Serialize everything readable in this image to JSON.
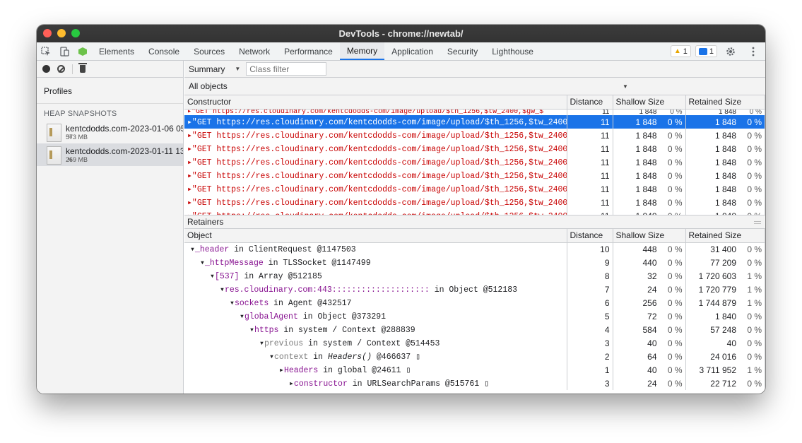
{
  "window": {
    "title": "DevTools - chrome://newtab/"
  },
  "tabs": [
    "Elements",
    "Console",
    "Sources",
    "Network",
    "Performance",
    "Memory",
    "Application",
    "Security",
    "Lighthouse"
  ],
  "active_tab": "Memory",
  "badges": {
    "warnings": "1",
    "messages": "1"
  },
  "sidebar": {
    "profiles_title": "Profiles",
    "section": "HEAP SNAPSHOTS",
    "snapshots": [
      {
        "title": "kentcdodds.com-2023-01-06 05",
        "size": "573 MB",
        "pct": "%"
      },
      {
        "title": "kentcdodds.com-2023-01-11 13",
        "size": "269 MB",
        "pct": "%"
      }
    ]
  },
  "toolbar": {
    "view": "Summary",
    "class_filter_placeholder": "Class filter",
    "objects_select": "All objects"
  },
  "constructor_table": {
    "headers": [
      "Constructor",
      "Distance",
      "Shallow Size",
      "Retained Size"
    ],
    "clipped_row": {
      "name": "▸\"GET https://res.cloudinary.com/kentcdodds-com/image/upload/$th_1256,$tw_2400,$gw_$",
      "distance": "11",
      "shallow": "1 848",
      "shallow_pct": "0 %",
      "retained": "1 848",
      "retained_pct": "0 %"
    },
    "rows": [
      {
        "name": "▸\"GET https://res.cloudinary.com/kentcdodds-com/image/upload/$th_1256,$tw_2400,$gw_$",
        "distance": "11",
        "shallow": "1 848",
        "shallow_pct": "0 %",
        "retained": "1 848",
        "retained_pct": "0 %"
      },
      {
        "name": "▸\"GET https://res.cloudinary.com/kentcdodds-com/image/upload/$th_1256,$tw_2400,$gw_$",
        "distance": "11",
        "shallow": "1 848",
        "shallow_pct": "0 %",
        "retained": "1 848",
        "retained_pct": "0 %"
      },
      {
        "name": "▸\"GET https://res.cloudinary.com/kentcdodds-com/image/upload/$th_1256,$tw_2400,$gw_$",
        "distance": "11",
        "shallow": "1 848",
        "shallow_pct": "0 %",
        "retained": "1 848",
        "retained_pct": "0 %"
      },
      {
        "name": "▸\"GET https://res.cloudinary.com/kentcdodds-com/image/upload/$th_1256,$tw_2400,$gw_$",
        "distance": "11",
        "shallow": "1 848",
        "shallow_pct": "0 %",
        "retained": "1 848",
        "retained_pct": "0 %"
      },
      {
        "name": "▸\"GET https://res.cloudinary.com/kentcdodds-com/image/upload/$th_1256,$tw_2400,$gw_$",
        "distance": "11",
        "shallow": "1 848",
        "shallow_pct": "0 %",
        "retained": "1 848",
        "retained_pct": "0 %"
      },
      {
        "name": "▸\"GET https://res.cloudinary.com/kentcdodds-com/image/upload/$th_1256,$tw_2400,$gw_$",
        "distance": "11",
        "shallow": "1 848",
        "shallow_pct": "0 %",
        "retained": "1 848",
        "retained_pct": "0 %"
      },
      {
        "name": "▸\"GET https://res.cloudinary.com/kentcdodds-com/image/upload/$th_1256,$tw_2400,$gw_$",
        "distance": "11",
        "shallow": "1 848",
        "shallow_pct": "0 %",
        "retained": "1 848",
        "retained_pct": "0 %"
      },
      {
        "name": "▸\"GET https://res.cloudinary.com/kentcdodds-com/image/upload/$th_1256,$tw_2400,$gw_$",
        "distance": "11",
        "shallow": "1 848",
        "shallow_pct": "0 %",
        "retained": "1 848",
        "retained_pct": "0 %"
      }
    ]
  },
  "retainers": {
    "title": "Retainers",
    "headers": [
      "Object",
      "Distance",
      "Shallow Size",
      "Retained Size"
    ],
    "rows": [
      {
        "arrow": "▾",
        "prop": "_header",
        "rest": " in ClientRequest @1147503",
        "distance": "10",
        "shallow": "448",
        "shallow_pct": "0 %",
        "retained": "31 400",
        "retained_pct": "0 %"
      },
      {
        "arrow": "▾",
        "prop": "_httpMessage",
        "rest": " in TLSSocket @1147499",
        "distance": "9",
        "shallow": "440",
        "shallow_pct": "0 %",
        "retained": "77 209",
        "retained_pct": "0 %"
      },
      {
        "arrow": "▾",
        "prop": "[537]",
        "rest": " in Array @512185",
        "distance": "8",
        "shallow": "32",
        "shallow_pct": "0 %",
        "retained": "1 720 603",
        "retained_pct": "1 %"
      },
      {
        "arrow": "▾",
        "prop": "res.cloudinary.com:443::::::::::::::::::::",
        "rest": " in Object @512183",
        "distance": "7",
        "shallow": "24",
        "shallow_pct": "0 %",
        "retained": "1 720 779",
        "retained_pct": "1 %"
      },
      {
        "arrow": "▾",
        "prop": "sockets",
        "rest": " in Agent @432517",
        "distance": "6",
        "shallow": "256",
        "shallow_pct": "0 %",
        "retained": "1 744 879",
        "retained_pct": "1 %"
      },
      {
        "arrow": "▾",
        "prop": "globalAgent",
        "rest": " in Object @373291",
        "distance": "5",
        "shallow": "72",
        "shallow_pct": "0 %",
        "retained": "1 840",
        "retained_pct": "0 %"
      },
      {
        "arrow": "▾",
        "prop": "https",
        "rest": " in system / Context @288839",
        "distance": "4",
        "shallow": "584",
        "shallow_pct": "0 %",
        "retained": "57 248",
        "retained_pct": "0 %"
      },
      {
        "arrow": "▾",
        "prop": "previous",
        "rest": " in system / Context @514453",
        "distance": "3",
        "shallow": "40",
        "shallow_pct": "0 %",
        "retained": "40",
        "retained_pct": "0 %",
        "gray": true
      },
      {
        "arrow": "▾",
        "prop": "context",
        "rest_pre": " in ",
        "rest_italic": "Headers()",
        "rest_post": " @466637 ▯",
        "distance": "2",
        "shallow": "64",
        "shallow_pct": "0 %",
        "retained": "24 016",
        "retained_pct": "0 %",
        "gray": true
      },
      {
        "arrow": "▸",
        "prop": "Headers",
        "rest": " in global @24611 ▯",
        "distance": "1",
        "shallow": "40",
        "shallow_pct": "0 %",
        "retained": "3 711 952",
        "retained_pct": "1 %"
      },
      {
        "arrow": "▸",
        "prop": "constructor",
        "rest": " in URLSearchParams @515761 ▯",
        "distance": "3",
        "shallow": "24",
        "shallow_pct": "0 %",
        "retained": "22 712",
        "retained_pct": "0 %"
      }
    ]
  },
  "icons": {
    "inspect": "inspect-element-icon",
    "device": "device-toolbar-icon",
    "node": "node-devtools-icon",
    "settings": "gear-icon",
    "more": "kebab-menu-icon",
    "record": "record-icon",
    "clear": "clear-icon",
    "trash": "trash-icon"
  }
}
